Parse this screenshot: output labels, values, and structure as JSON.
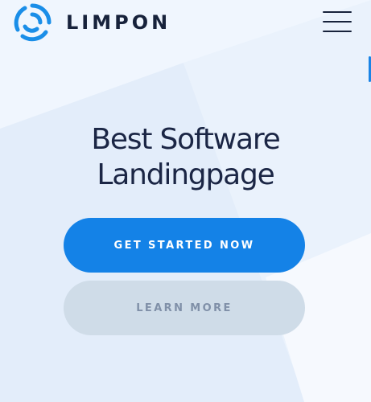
{
  "brand": {
    "name": "LIMPON",
    "logo_icon": "ring-logo-icon"
  },
  "header": {
    "menu_icon": "hamburger-menu-icon"
  },
  "hero": {
    "title_line1": "Best Software",
    "title_line2": "Landingpage"
  },
  "buttons": {
    "primary_label": "GET STARTED NOW",
    "secondary_label": "LEARN MORE"
  },
  "colors": {
    "accent": "#1482e7",
    "text_dark": "#1b2645",
    "secondary_button": "#cfdce8",
    "background": "#f0f6fe"
  }
}
